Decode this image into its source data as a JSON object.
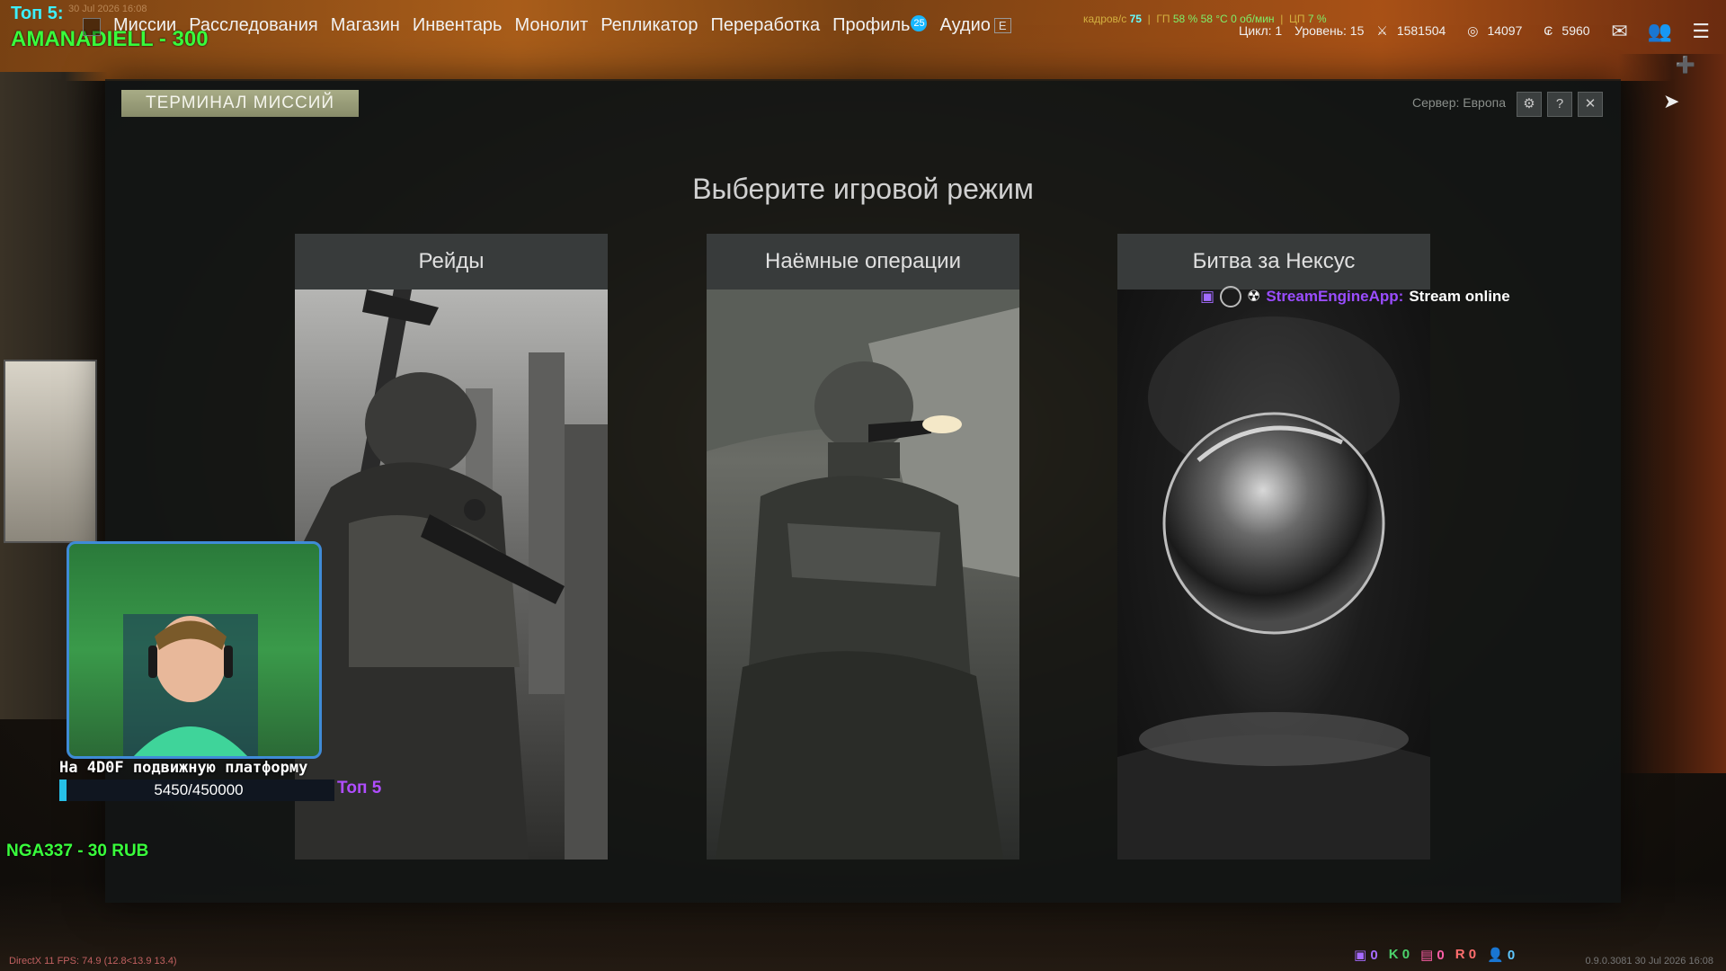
{
  "overlay": {
    "top5_label": "Топ 5:",
    "top5_date": "30 Jul 2026 16:08",
    "top5_user": "AMANADIELL - 300",
    "goal_text": "На 4D0F подвижную платформу",
    "goal_value": "5450/450000",
    "goal_progress_fraction": 0.0121,
    "goal_top5": "Топ 5",
    "donation": "NGA337 - 30 RUB"
  },
  "nav": {
    "items": [
      {
        "label": "Миссии"
      },
      {
        "label": "Расследования"
      },
      {
        "label": "Магазин"
      },
      {
        "label": "Инвентарь"
      },
      {
        "label": "Монолит"
      },
      {
        "label": "Репликатор"
      },
      {
        "label": "Переработка"
      },
      {
        "label": "Профиль",
        "badge": "25"
      },
      {
        "label": "Аудио",
        "key": "E"
      }
    ]
  },
  "stats": {
    "fps_label": "кадров/с",
    "fps_value": "75",
    "gpu": "ГП",
    "gpu_load": "58 %",
    "gpu_temp": "58 °C",
    "gpu_rpm": "0 об/мин",
    "cpu": "ЦП",
    "cpu_load": "7 %",
    "cycle": "Цикл: 1",
    "level": "Уровень: 15",
    "currency1": "1581504",
    "currency2": "14097",
    "currency3": "5960"
  },
  "panel": {
    "tag": "ТЕРМИНАЛ МИССИЙ",
    "server": "Сервер: Европа",
    "title": "Выберите игровой режим",
    "modes": [
      {
        "name": "Рейды"
      },
      {
        "name": "Наёмные операции"
      },
      {
        "name": "Битва за Нексус"
      }
    ]
  },
  "stream_notice": {
    "app": "StreamEngineApp:",
    "message": "Stream online"
  },
  "bottom": {
    "directx": "DirectX 11 FPS: 74.9 (12.8<13.9 13.4)",
    "right_info": "0.9.0.3081 30 Jul 2026 16:08",
    "counters": [
      "0",
      "0",
      "0",
      "0",
      "0"
    ]
  },
  "icons": {
    "mail": "mail-icon",
    "friends": "friends-icon",
    "menu": "menu-icon"
  }
}
